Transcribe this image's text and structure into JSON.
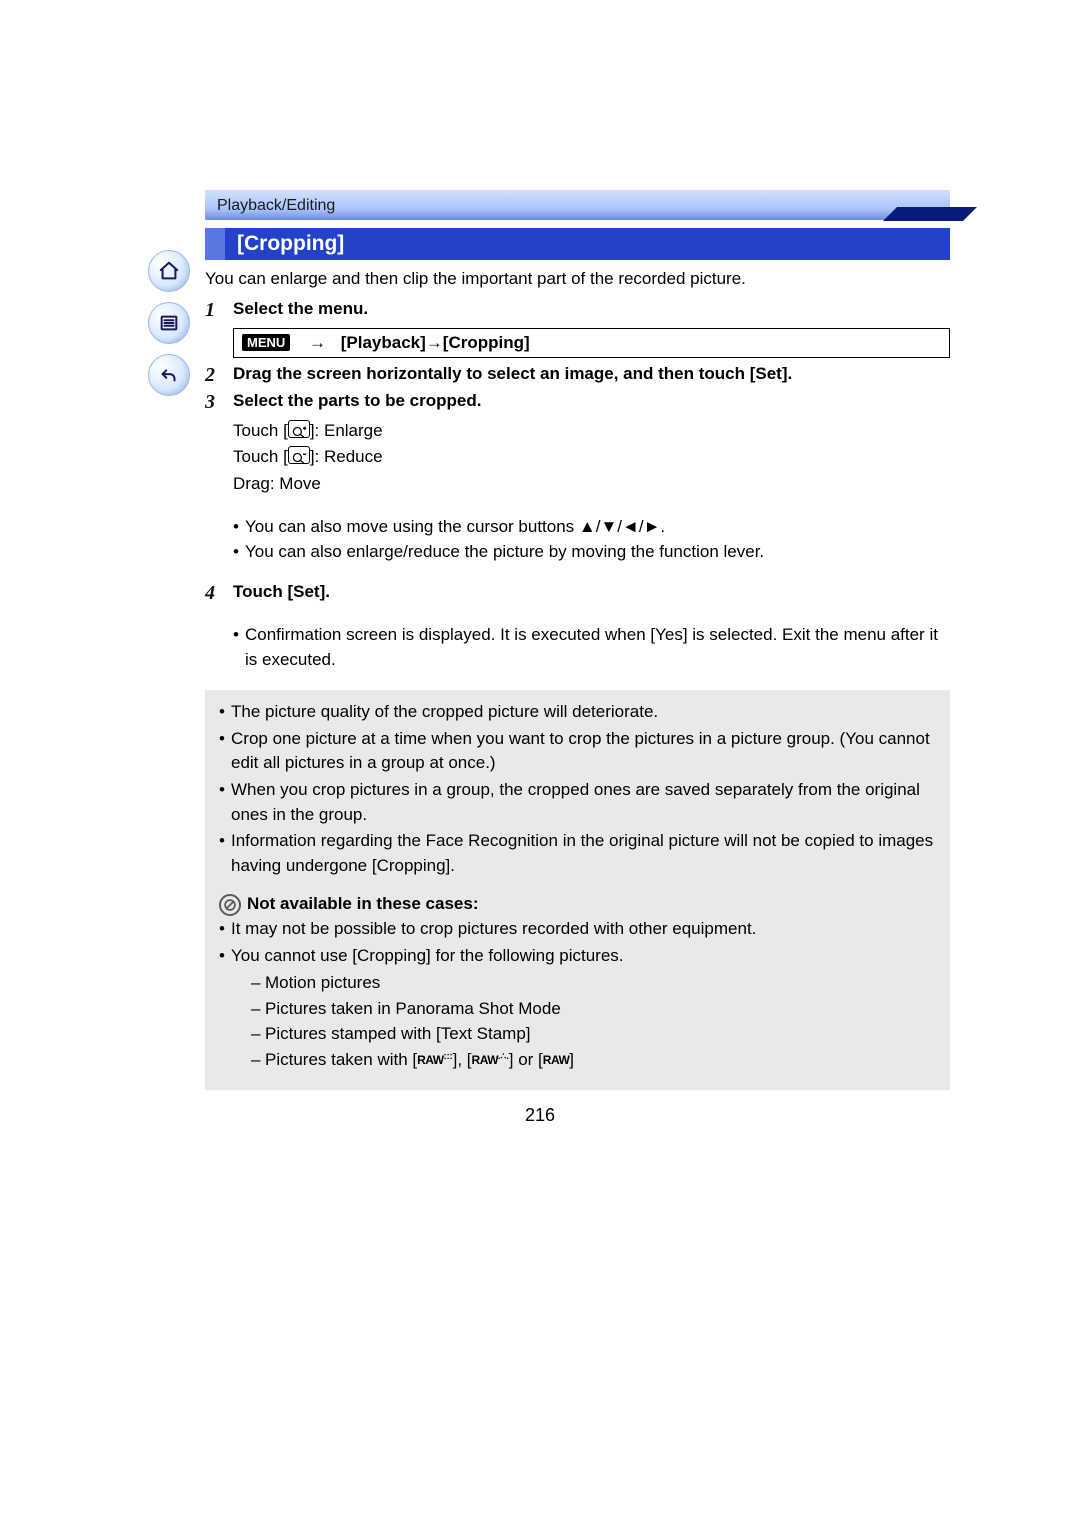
{
  "breadcrumb": "Playback/Editing",
  "section_title": "[Cropping]",
  "intro": "You can enlarge and then clip the important part of the recorded picture.",
  "steps": {
    "s1": {
      "num": "1",
      "title": "Select the menu."
    },
    "menu": {
      "chip": "MENU",
      "arrow": "→",
      "path": "[Playback]→[Cropping]"
    },
    "s2": {
      "num": "2",
      "title": "Drag the screen horizontally to select an image, and then touch [Set]."
    },
    "s3": {
      "num": "3",
      "title": "Select the parts to be cropped.",
      "touch_enlarge_pre": "Touch [",
      "touch_enlarge_post": "]: Enlarge",
      "touch_reduce_pre": "Touch [",
      "touch_reduce_post": "]: Reduce",
      "drag": "Drag: Move",
      "b1_pre": "You can also move using the cursor buttons ",
      "b1_glyphs": "▲/▼/◄/►",
      "b1_post": ".",
      "b2": "You can also enlarge/reduce the picture by moving the function lever."
    },
    "s4": {
      "num": "4",
      "title": "Touch [Set].",
      "b1": "Confirmation screen is displayed. It is executed when [Yes] is selected. Exit the menu after it is executed."
    }
  },
  "notes": {
    "n1": "The picture quality of the cropped picture will deteriorate.",
    "n2": "Crop one picture at a time when you want to crop the pictures in a picture group. (You cannot edit all pictures in a group at once.)",
    "n3": "When you crop pictures in a group, the cropped ones are saved separately from the original ones in the group.",
    "n4": "Information regarding the Face Recognition in the original picture will not be copied to images having undergone [Cropping]."
  },
  "na": {
    "heading": "Not available in these cases:",
    "b1": "It may not be possible to crop pictures recorded with other equipment.",
    "b2": "You cannot use [Cropping] for the following pictures.",
    "d1": "Motion pictures",
    "d2": "Pictures taken in Panorama Shot Mode",
    "d3": "Pictures stamped with [Text Stamp]",
    "d4_pre": "Pictures taken with [",
    "d4_mid1": "], [",
    "d4_mid2": "] or [",
    "d4_post": "]",
    "raw1": "RAW",
    "raw2": "RAW",
    "raw3": "RAW"
  },
  "page_number": "216"
}
